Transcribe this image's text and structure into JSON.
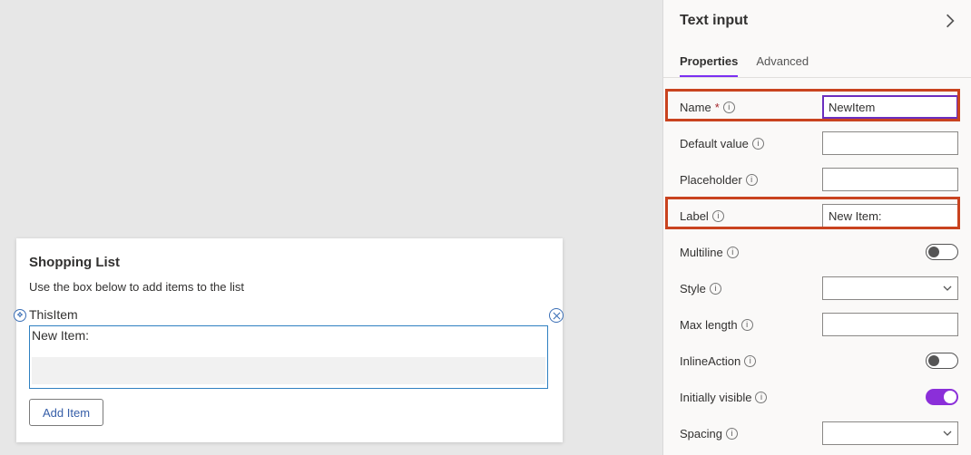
{
  "canvas": {
    "card_title": "Shopping List",
    "card_subtitle": "Use the box below to add items to the list",
    "selection_name": "ThisItem",
    "field_label": "New Item:",
    "add_button": "Add Item"
  },
  "panel": {
    "title": "Text input",
    "tabs": {
      "properties": "Properties",
      "advanced": "Advanced"
    },
    "rows": {
      "name": {
        "label": "Name",
        "value": "NewItem",
        "required": true
      },
      "default_value": {
        "label": "Default value",
        "value": ""
      },
      "placeholder": {
        "label": "Placeholder",
        "value": ""
      },
      "label": {
        "label": "Label",
        "value": "New Item:"
      },
      "multiline": {
        "label": "Multiline",
        "on": false
      },
      "style": {
        "label": "Style",
        "value": ""
      },
      "max_length": {
        "label": "Max length",
        "value": ""
      },
      "inline_action": {
        "label": "InlineAction",
        "on": false
      },
      "initially_visible": {
        "label": "Initially visible",
        "on": true
      },
      "spacing": {
        "label": "Spacing",
        "value": ""
      }
    }
  }
}
